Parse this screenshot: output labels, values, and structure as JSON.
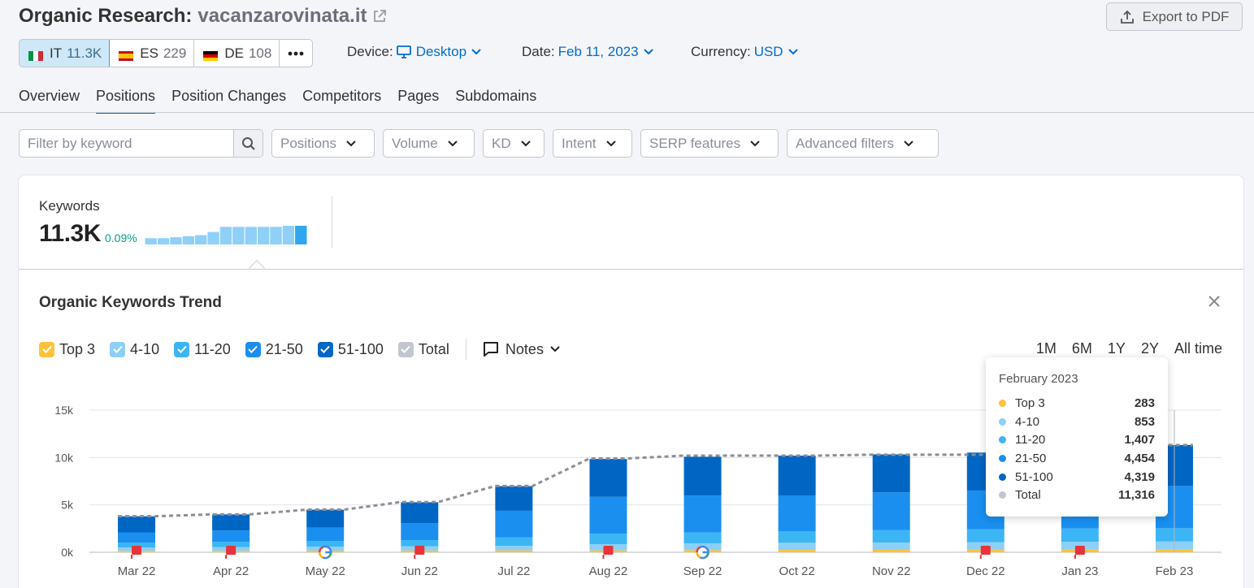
{
  "header": {
    "title": "Organic Research:",
    "domain": "vacanzarovinata.it",
    "export_label": "Export to PDF"
  },
  "databases": [
    {
      "code": "IT",
      "count": "11.3K",
      "active": true
    },
    {
      "code": "ES",
      "count": "229",
      "active": false
    },
    {
      "code": "DE",
      "count": "108",
      "active": false
    }
  ],
  "options": {
    "device_label": "Device:",
    "device_value": "Desktop",
    "date_label": "Date:",
    "date_value": "Feb 11, 2023",
    "currency_label": "Currency:",
    "currency_value": "USD"
  },
  "tabs": [
    "Overview",
    "Positions",
    "Position Changes",
    "Competitors",
    "Pages",
    "Subdomains"
  ],
  "active_tab": "Positions",
  "filters": {
    "search_placeholder": "Filter by keyword",
    "buttons": [
      "Positions",
      "Volume",
      "KD",
      "Intent",
      "SERP features",
      "Advanced filters"
    ]
  },
  "summary": {
    "label": "Keywords",
    "value": "11.3K",
    "delta": "0.09%",
    "sparkline": [
      3,
      3,
      3.5,
      4,
      4.5,
      6,
      8.5,
      8.5,
      8.5,
      8.5,
      8.5,
      9,
      9
    ]
  },
  "trend": {
    "title": "Organic Keywords Trend",
    "legend": [
      {
        "label": "Top 3",
        "color": "#ffc23b"
      },
      {
        "label": "4-10",
        "color": "#8ccff7"
      },
      {
        "label": "11-20",
        "color": "#3cb5f5"
      },
      {
        "label": "21-50",
        "color": "#1a8ff0"
      },
      {
        "label": "51-100",
        "color": "#0066c4"
      },
      {
        "label": "Total",
        "color": "#c3c6cf"
      }
    ],
    "notes_label": "Notes",
    "ranges": [
      "1M",
      "6M",
      "1Y",
      "2Y",
      "All time"
    ]
  },
  "chart_data": {
    "type": "bar",
    "stacked": true,
    "categories": [
      "Mar 22",
      "Apr 22",
      "May 22",
      "Jun 22",
      "Jul 22",
      "Aug 22",
      "Sep 22",
      "Oct 22",
      "Nov 22",
      "Dec 22",
      "Jan 23",
      "Feb 23"
    ],
    "series": [
      {
        "name": "Top 3",
        "color": "#ffc23b",
        "values": [
          150,
          150,
          180,
          180,
          200,
          200,
          230,
          250,
          260,
          270,
          280,
          283
        ]
      },
      {
        "name": "4-10",
        "color": "#8ccff7",
        "values": [
          350,
          400,
          420,
          450,
          480,
          650,
          700,
          750,
          770,
          800,
          830,
          853
        ]
      },
      {
        "name": "11-20",
        "color": "#3cb5f5",
        "values": [
          500,
          550,
          600,
          650,
          900,
          1100,
          1150,
          1200,
          1300,
          1350,
          1400,
          1407
        ]
      },
      {
        "name": "21-50",
        "color": "#1a8ff0",
        "values": [
          1100,
          1200,
          1400,
          1800,
          2800,
          3900,
          3900,
          3800,
          4000,
          4100,
          4400,
          4454
        ]
      },
      {
        "name": "51-100",
        "color": "#0066c4",
        "values": [
          1700,
          1700,
          1900,
          2200,
          2600,
          4000,
          4100,
          4200,
          4000,
          4000,
          4300,
          4319
        ]
      }
    ],
    "total": [
      3800,
      4000,
      4500,
      5300,
      7000,
      9900,
      10200,
      10200,
      10300,
      10300,
      11200,
      11316
    ],
    "ylim": [
      0,
      15000
    ],
    "yticks": [
      "0k",
      "5k",
      "10k",
      "15k"
    ],
    "notes_markers": [
      "flag",
      "flag",
      "google",
      "flag",
      "",
      "flag",
      "google",
      "",
      "",
      "flag",
      "flag",
      ""
    ],
    "grid": true
  },
  "tooltip": {
    "title": "February 2023",
    "rows": [
      {
        "name": "Top 3",
        "value": "283",
        "color": "#ffc23b"
      },
      {
        "name": "4-10",
        "value": "853",
        "color": "#8ccff7"
      },
      {
        "name": "11-20",
        "value": "1,407",
        "color": "#3cb5f5"
      },
      {
        "name": "21-50",
        "value": "4,454",
        "color": "#1a8ff0"
      },
      {
        "name": "51-100",
        "value": "4,319",
        "color": "#0066c4"
      },
      {
        "name": "Total",
        "value": "11,316",
        "color": "#c3c6cf"
      }
    ]
  }
}
